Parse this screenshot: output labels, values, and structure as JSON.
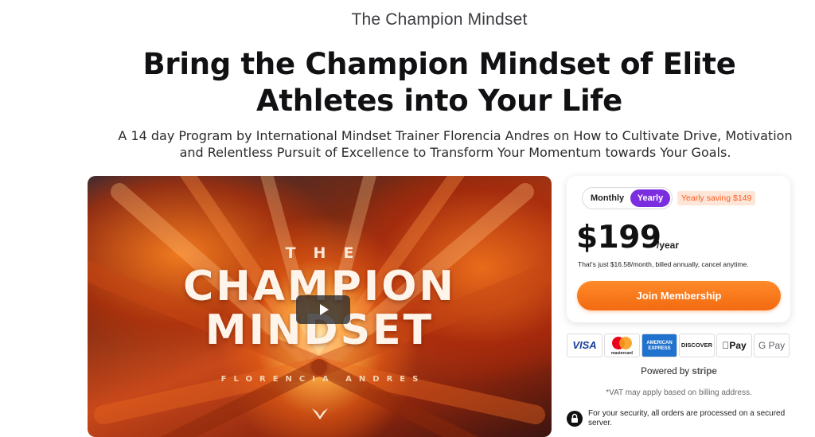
{
  "header": {
    "brand": "The Champion Mindset"
  },
  "hero": {
    "headline_line1": "Bring the Champion Mindset of Elite",
    "headline_line2": "Athletes into Your Life",
    "subhead_line1": "A 14 day Program by International Mindset Trainer Florencia Andres on How to Cultivate Drive, Motivation",
    "subhead_line2": "and Relentless Pursuit of Excellence to Transform Your Momentum towards Your Goals."
  },
  "video": {
    "the": "THE",
    "title_line1": "CHAMPION",
    "title_line2": "MINDSET",
    "author": "FLORENCIA ANDRES",
    "play_icon": "play-icon",
    "logo_icon": "mindvalley-logo-icon"
  },
  "pricing": {
    "toggle_monthly": "Monthly",
    "toggle_yearly": "Yearly",
    "selected": "Yearly",
    "saving": "Yearly saving $149",
    "price": "$199",
    "period": "/year",
    "note": "That's just $16.58/month, billed annually, cancel anytime.",
    "cta": "Join Membership",
    "accent_color": "#7b2ee0",
    "cta_color": "#f36a10"
  },
  "payments": {
    "visa": "VISA",
    "mastercard": "mastercard",
    "amex": "AMERICAN EXPRESS",
    "discover": "DISCOVER",
    "apple_pay": "Pay",
    "google_pay": "G Pay"
  },
  "footer": {
    "powered_by": "Powered by",
    "stripe": "stripe",
    "vat": "*VAT may apply based on billing address.",
    "security_line": "For your security, all orders are processed on a secured server.",
    "lock_icon": "lock-icon"
  }
}
